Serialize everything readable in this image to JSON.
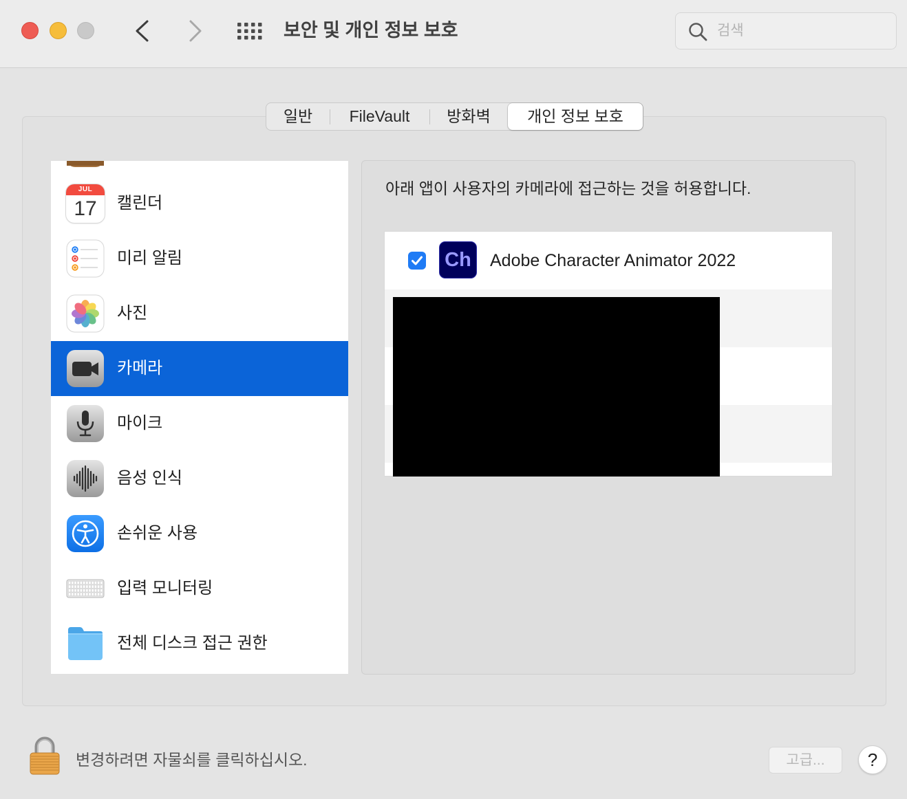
{
  "window": {
    "title": "보안 및 개인 정보 보호"
  },
  "toolbar": {
    "back_icon": "chevron-left-icon",
    "forward_icon": "chevron-right-icon",
    "show_all_icon": "grid-icon",
    "search": {
      "icon": "search-icon",
      "placeholder": "검색",
      "value": ""
    }
  },
  "tabs": [
    {
      "label": "일반",
      "selected": false
    },
    {
      "label": "FileVault",
      "selected": false
    },
    {
      "label": "방화벽",
      "selected": false
    },
    {
      "label": "개인 정보 보호",
      "selected": true
    }
  ],
  "sidebar": {
    "items": [
      {
        "icon": "contacts-icon"
      },
      {
        "label": "캘린더",
        "icon": "calendar-icon",
        "icon_text": {
          "month": "JUL",
          "day": "17"
        }
      },
      {
        "label": "미리 알림",
        "icon": "reminders-icon"
      },
      {
        "label": "사진",
        "icon": "photos-icon"
      },
      {
        "label": "카메라",
        "icon": "camera-icon",
        "selected": true
      },
      {
        "label": "마이크",
        "icon": "microphone-icon"
      },
      {
        "label": "음성 인식",
        "icon": "speech-recognition-icon"
      },
      {
        "label": "손쉬운 사용",
        "icon": "accessibility-icon"
      },
      {
        "label": "입력 모니터링",
        "icon": "keyboard-icon"
      },
      {
        "label": "전체 디스크 접근 권한",
        "icon": "folder-icon"
      }
    ]
  },
  "detail": {
    "description": "아래 앱이 사용자의 카메라에 접근하는 것을 허용합니다.",
    "apps": [
      {
        "name": "Adobe Character Animator 2022",
        "checked": true,
        "icon": "character-animator-icon",
        "icon_text": "Ch"
      }
    ]
  },
  "footer": {
    "lock_icon": "lock-icon",
    "message": "변경하려면 자물쇠를 클릭하십시오.",
    "advanced_button": {
      "label": "고급...",
      "enabled": false
    },
    "help_button": {
      "label": "?"
    }
  },
  "colors": {
    "close-button": "#ee5c54",
    "minimize-button": "#f6bd3b",
    "zoom-button": "#c9c9c9",
    "selection": "#0b64d8",
    "checkbox": "#1f7bf5",
    "app-icon-bg": "#00005b",
    "app-icon-text": "#9999ff"
  }
}
